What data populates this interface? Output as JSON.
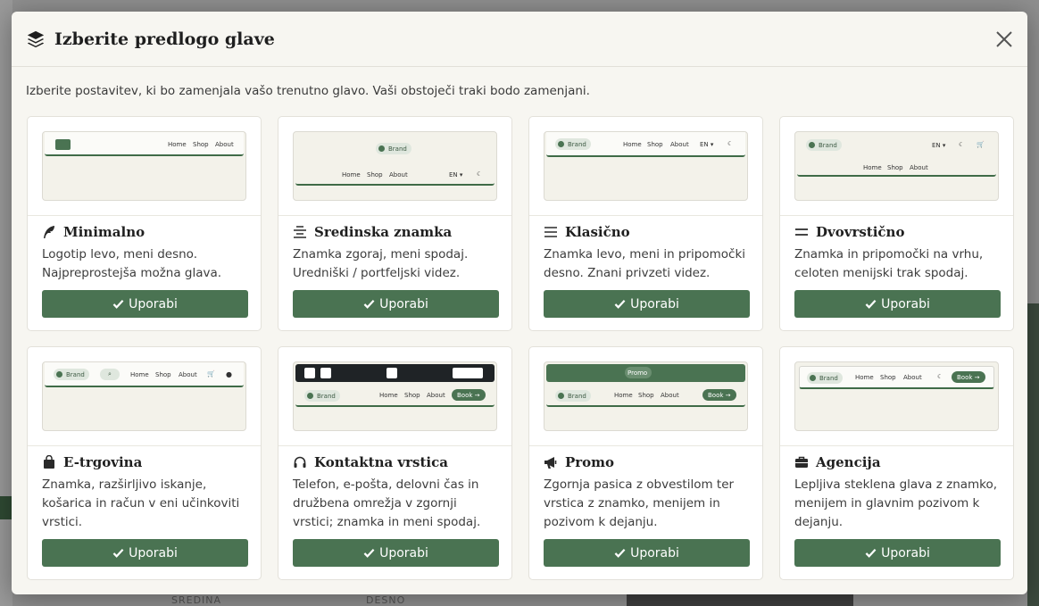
{
  "modal": {
    "title": "Izberite predlogo glave",
    "intro": "Izberite postavitev, ki bo zamenjala vašo trenutno glavo. Vaši obstoječi traki bodo zamenjani.",
    "apply_label": "Uporabi"
  },
  "preview": {
    "brand": "Brand",
    "home": "Home",
    "shop": "Shop",
    "about": "About",
    "lang": "EN ▾",
    "book": "Book →",
    "promo": "Promo"
  },
  "cards": [
    {
      "title": "Minimalno",
      "desc": "Logotip levo, meni desno. Najpreprostejša možna glava.",
      "icon": "feather-icon"
    },
    {
      "title": "Sredinska znamka",
      "desc": "Znamka zgoraj, meni spodaj. Uredniški / portfeljski videz.",
      "icon": "align-center-icon"
    },
    {
      "title": "Klasično",
      "desc": "Znamka levo, meni in pripomočki desno. Znani privzeti videz.",
      "icon": "bars-icon"
    },
    {
      "title": "Dvovrstično",
      "desc": "Znamka in pripomočki na vrhu, celoten menijski trak spodaj.",
      "icon": "equals-icon"
    },
    {
      "title": "E-trgovina",
      "desc": "Znamka, razširljivo iskanje, košarica in račun v eni učinkoviti vrstici.",
      "icon": "shopping-bag-icon"
    },
    {
      "title": "Kontaktna vrstica",
      "desc": "Telefon, e-pošta, delovni čas in družbena omrežja v zgornji vrstici; znamka in meni spodaj.",
      "icon": "headset-icon"
    },
    {
      "title": "Promo",
      "desc": "Zgornja pasica z obvestilom ter vrstica z znamko, menijem in pozivom k dejanju.",
      "icon": "megaphone-icon"
    },
    {
      "title": "Agencija",
      "desc": "Lepljiva steklena glava z znamko, menijem in glavnim pozivom k dejanju.",
      "icon": "briefcase-icon"
    }
  ],
  "background": {
    "bottom_left": "SREDINA",
    "bottom_right": "DESNO"
  }
}
